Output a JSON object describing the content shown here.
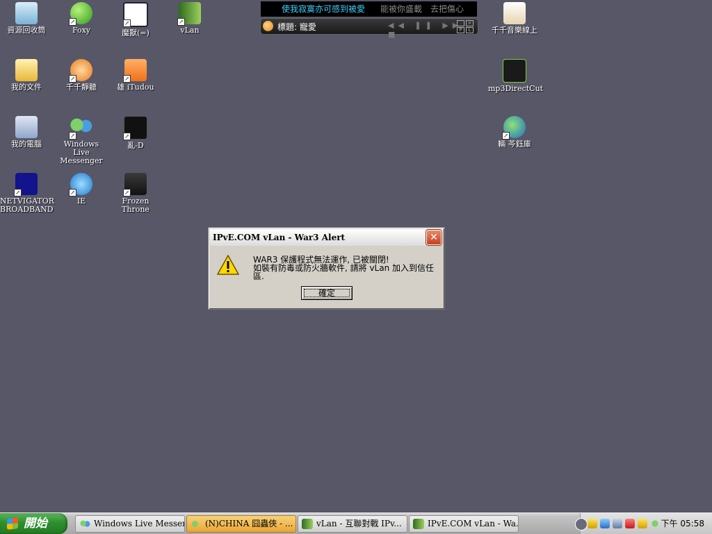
{
  "desktop": {
    "icons": [
      {
        "label": "資源回收筒",
        "icon": "recycle-bin-icon"
      },
      {
        "label": "Foxy",
        "icon": "foxy-icon"
      },
      {
        "label": "魔獸(=)",
        "icon": "warcraft-app-icon"
      },
      {
        "label": "vLan",
        "icon": "vlan-icon"
      },
      {
        "label": "我的文件",
        "icon": "my-documents-icon"
      },
      {
        "label": "千千靜聽",
        "icon": "ttplayer-icon"
      },
      {
        "label": "雄 iTudou",
        "icon": "itudou-icon"
      },
      {
        "label": "我的電腦",
        "icon": "my-computer-icon"
      },
      {
        "label": "Windows Live Messenger",
        "icon": "messenger-icon"
      },
      {
        "label": "亂-D",
        "icon": "luan-d-icon"
      },
      {
        "label": "NETVIGATOR BROADBAND",
        "icon": "netvigator-icon"
      },
      {
        "label": "IE",
        "icon": "internet-explorer-icon"
      },
      {
        "label": "Frozen Throne",
        "icon": "frozen-throne-icon"
      },
      {
        "label": "千千音樂線上",
        "icon": "ttmusic-online-icon"
      },
      {
        "label": "mp3DirectCut",
        "icon": "mp3directcut-icon"
      },
      {
        "label": "輛  芩鈺庫",
        "icon": "globe-library-icon"
      }
    ]
  },
  "lyrics": {
    "line1": "使我寂寞亦可感到被愛",
    "line2": "能被你盛載",
    "line3": "去把傷心"
  },
  "player": {
    "title": "標題: 寵愛",
    "controls": "◀◀ ❚❚ ▶▶ ■"
  },
  "dialog": {
    "title": "IPvE.COM vLan - War3 Alert",
    "message_line1": "WAR3 保護程式無法運作, 已被關閉!",
    "message_line2": "如裝有防毒或防火牆軟件, 請將 vLan 加入到信任區.",
    "ok_label": "確定",
    "close_glyph": "✕"
  },
  "taskbar": {
    "start_label": "開始",
    "tasks": [
      {
        "label": "Windows Live Messen...",
        "active": false
      },
      {
        "label": "(N)CHINA 囧蟲俠 - ...",
        "active": true
      },
      {
        "label": "vLan - 互聯對戰 IPv...",
        "active": false
      },
      {
        "label": "IPvE.COM vLan - Wa...",
        "active": false
      }
    ],
    "clock": "下午 05:58"
  },
  "colors": {
    "desktop_bg": "#575768",
    "start_green": "#2e8f2e",
    "dialog_face": "#d4d0c8",
    "close_red": "#c6401f"
  }
}
